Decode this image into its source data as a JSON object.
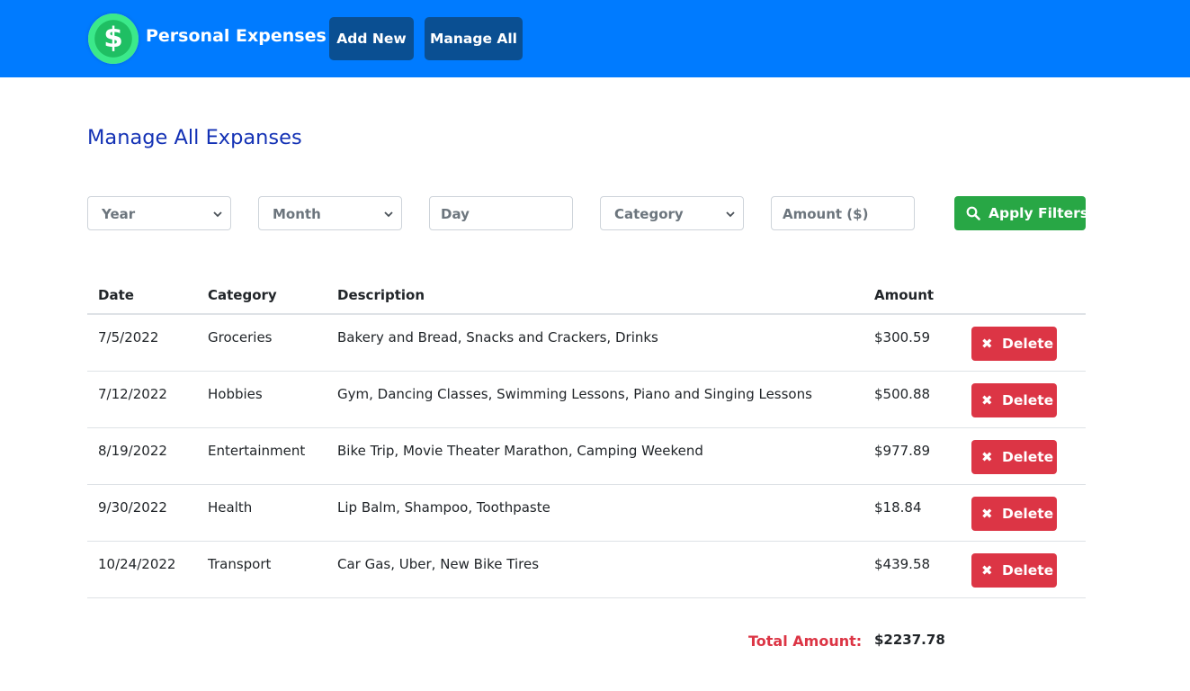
{
  "navbar": {
    "logo_symbol": "$",
    "brand": "Personal Expenses",
    "add_new": "Add New",
    "manage_all": "Manage All",
    "color": "#007bff"
  },
  "page_title": "Manage All Expanses",
  "filters": {
    "year": "Year",
    "month": "Month",
    "day_placeholder": "Day",
    "category": "Category",
    "amount_placeholder": "Amount ($)",
    "apply": "Apply Filters",
    "apply_icon": "search-icon"
  },
  "table": {
    "headers": [
      "Date",
      "Category",
      "Description",
      "Amount"
    ],
    "delete_label": "Delete",
    "delete_icon": "close-icon",
    "rows": [
      {
        "date": "7/5/2022",
        "category": "Groceries",
        "description": "Bakery and Bread, Snacks and Crackers, Drinks",
        "amount": "$300.59"
      },
      {
        "date": "7/12/2022",
        "category": "Hobbies",
        "description": "Gym, Dancing Classes, Swimming Lessons, Piano and Singing Lessons",
        "amount": "$500.88"
      },
      {
        "date": "8/19/2022",
        "category": "Entertainment",
        "description": "Bike Trip, Movie Theater Marathon, Camping Weekend",
        "amount": "$977.89"
      },
      {
        "date": "9/30/2022",
        "category": "Health",
        "description": "Lip Balm, Shampoo, Toothpaste",
        "amount": "$18.84"
      },
      {
        "date": "10/24/2022",
        "category": "Transport",
        "description": "Car Gas, Uber, New Bike Tires",
        "amount": "$439.58"
      }
    ]
  },
  "total": {
    "label": "Total Amount:",
    "value": "$2237.78"
  },
  "colors": {
    "apply": "#28a745",
    "delete": "#dc3545",
    "title": "#1432b5"
  }
}
